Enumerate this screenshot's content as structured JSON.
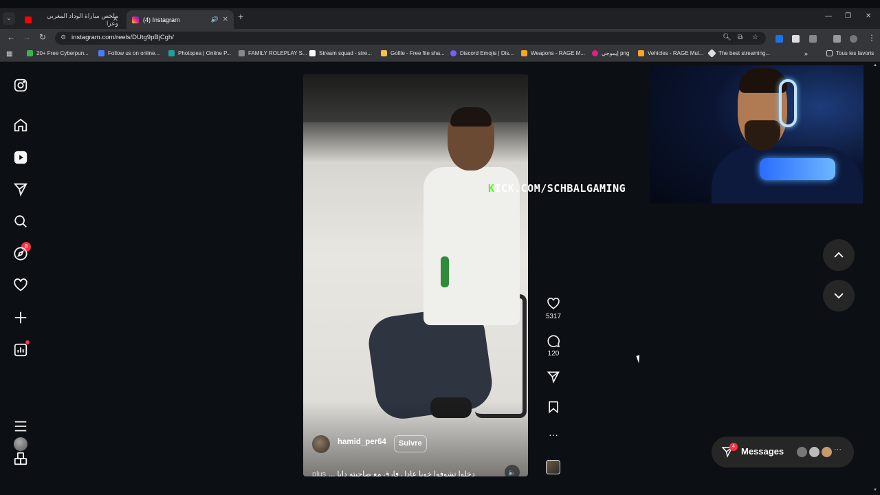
{
  "tabs": [
    {
      "title": "ملخص مباراة الوداد المغربي وعزا",
      "active": false
    },
    {
      "title": "(4) Instagram",
      "active": true
    }
  ],
  "address": {
    "url": "instagram.com/reels/DUtg9pBjCgh/"
  },
  "bookmarks": [
    {
      "label": "20+ Free Cyberpun...",
      "color": "#3bb54a"
    },
    {
      "label": "Follow us on online...",
      "color": "#4a7cff"
    },
    {
      "label": "Photopea | Online P...",
      "color": "#18a497"
    },
    {
      "label": "FAMILY ROLEPLAY S...",
      "color": "#888888"
    },
    {
      "label": "Stream squad - stre...",
      "color": "#ffffff"
    },
    {
      "label": "Gofile - Free file sha...",
      "color": "#f2c14e"
    },
    {
      "label": "Discord Emojis | Dis...",
      "color": "#7b5cff"
    },
    {
      "label": "Weapons - RAGE M...",
      "color": "#f5a623"
    },
    {
      "label": "إيموجي png",
      "color": "#e0207e"
    },
    {
      "label": "Vehicles - RAGE Mul...",
      "color": "#f5a623"
    },
    {
      "label": "The best streaming...",
      "color": "#dddddd"
    }
  ],
  "bookmarks_all": "Tous les favoris",
  "sidebar": {
    "notifications_badge": "8"
  },
  "reel": {
    "author": "hamid_per64",
    "follow_label": "Suivre",
    "caption": "دخلوا تشوفوا خويا عادل فارق مع صاحبته دابا ...",
    "more_label": "plus",
    "overlay_text": "KICK.COM/SCHBALGAMING",
    "overlay_first": "K",
    "overlay_rest": "ICK.COM/SCHBALGAMING",
    "likes": "5317",
    "comments": "120"
  },
  "messages": {
    "label": "Messages",
    "badge": "4",
    "more": "···"
  },
  "colors": {
    "accent_red": "#ff3040",
    "kick_green": "#53fc18"
  }
}
